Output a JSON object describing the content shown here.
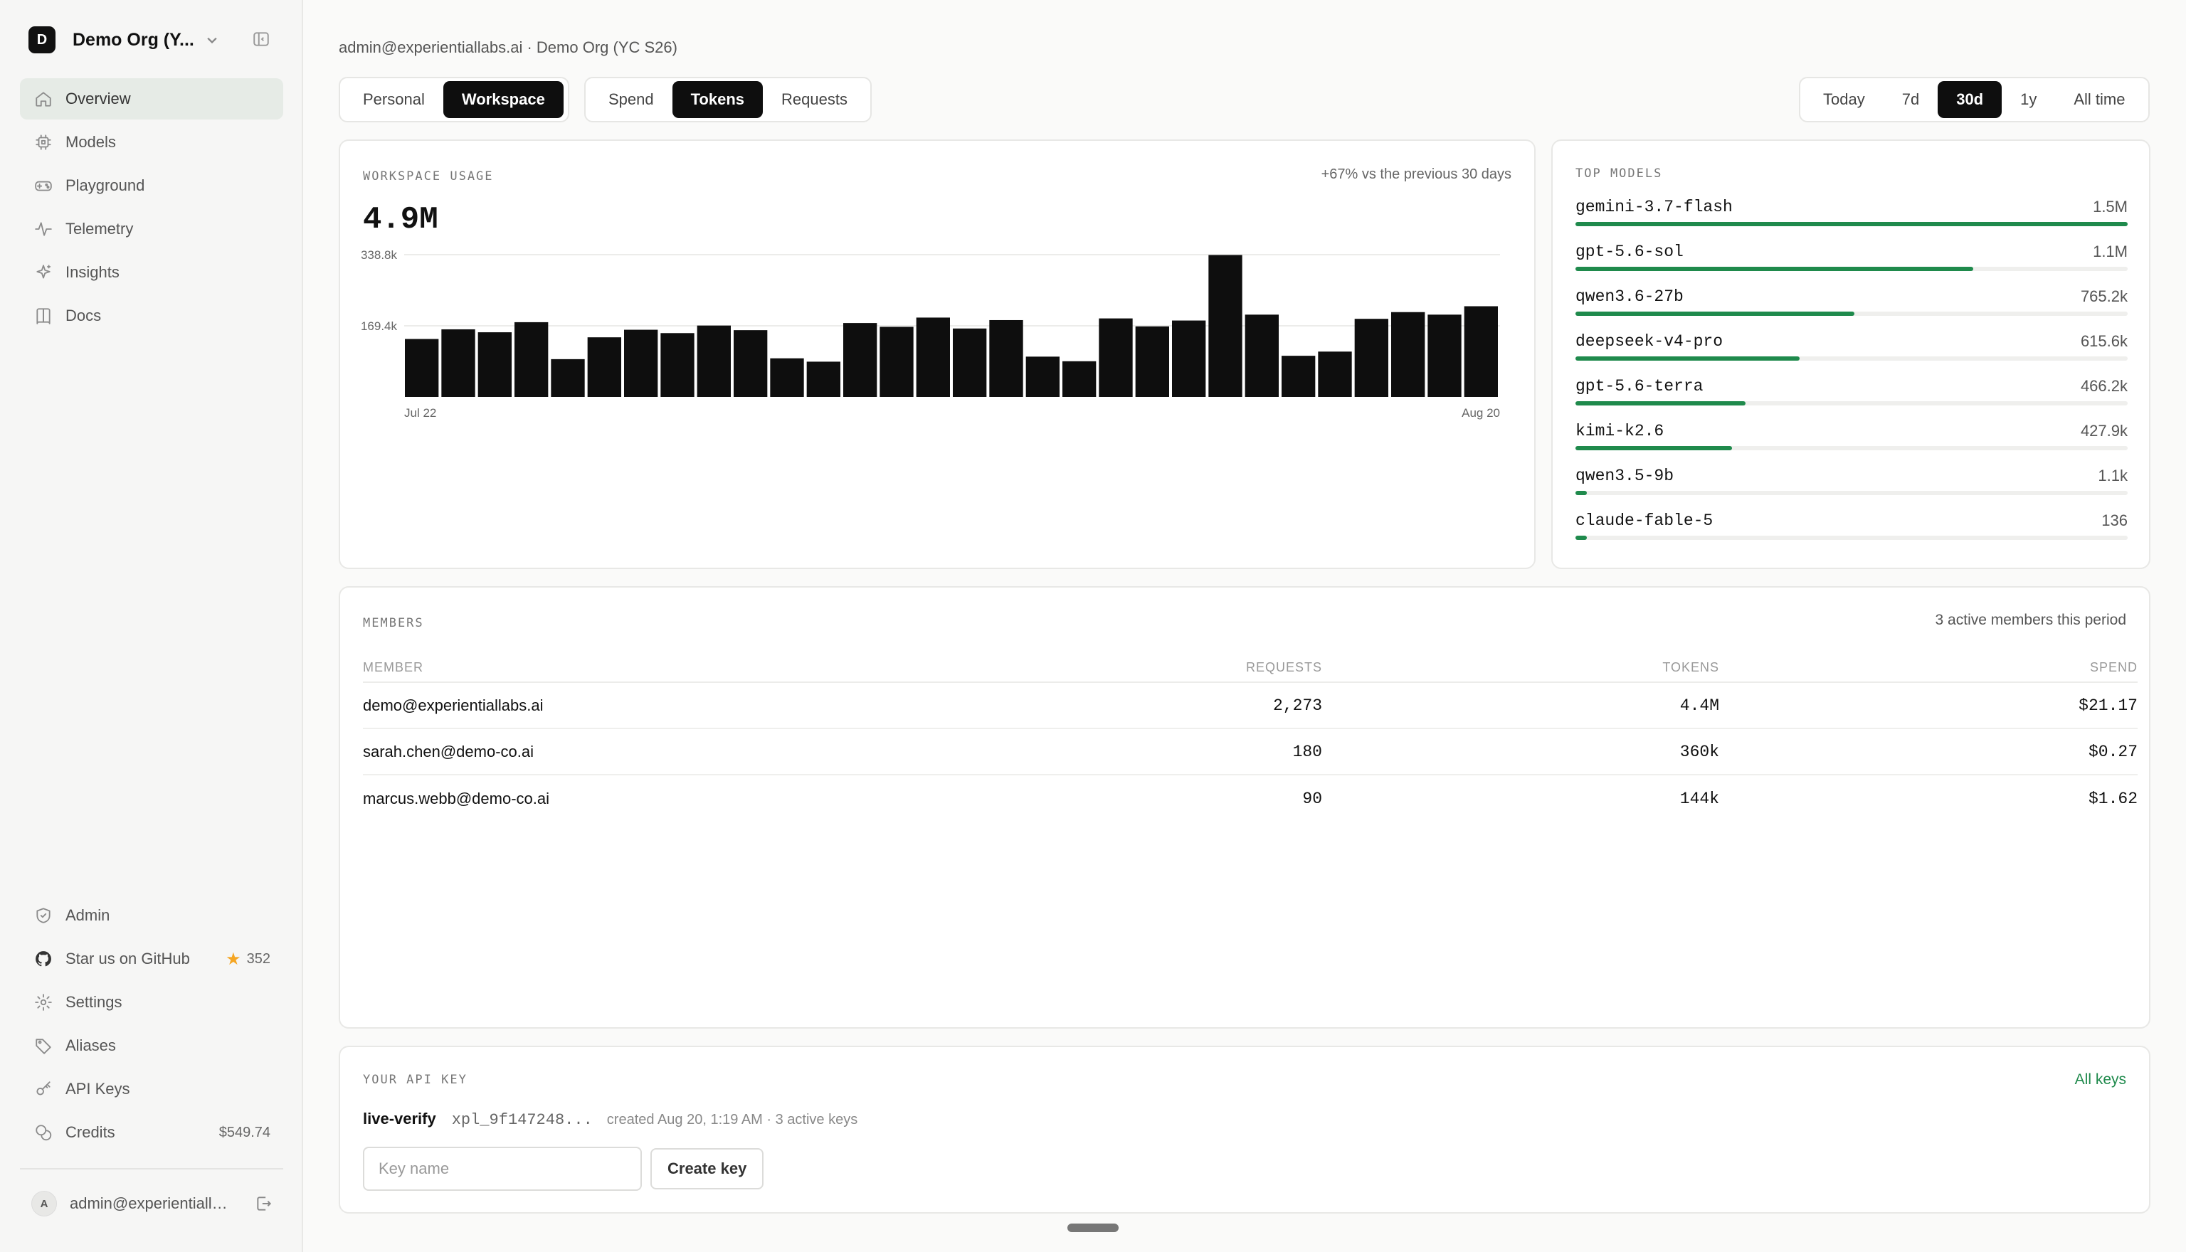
{
  "sidebar": {
    "org": {
      "initial": "D",
      "name": "Demo Org (Y..."
    },
    "nav": [
      {
        "label": "Overview",
        "icon": "home-icon",
        "active": true
      },
      {
        "label": "Models",
        "icon": "chip-icon"
      },
      {
        "label": "Playground",
        "icon": "gamepad-icon"
      },
      {
        "label": "Telemetry",
        "icon": "pulse-icon"
      },
      {
        "label": "Insights",
        "icon": "sparkles-icon"
      },
      {
        "label": "Docs",
        "icon": "book-icon"
      }
    ],
    "bottom": [
      {
        "label": "Admin",
        "icon": "shield-icon"
      },
      {
        "label": "Star us on GitHub",
        "icon": "github-icon",
        "badge": "352"
      },
      {
        "label": "Settings",
        "icon": "gear-icon"
      },
      {
        "label": "Aliases",
        "icon": "tag-icon"
      },
      {
        "label": "API Keys",
        "icon": "key-icon"
      },
      {
        "label": "Credits",
        "icon": "coins-icon",
        "badge": "$549.74"
      }
    ],
    "user": {
      "initial": "A",
      "email": "admin@experientiallabs.ai"
    }
  },
  "breadcrumb": "admin@experientiallabs.ai · Demo Org (YC S26)",
  "scope_tabs": [
    "Personal",
    "Workspace"
  ],
  "scope_active": "Workspace",
  "metric_tabs": [
    "Spend",
    "Tokens",
    "Requests"
  ],
  "metric_active": "Tokens",
  "range_tabs": [
    "Today",
    "7d",
    "30d",
    "1y",
    "All time"
  ],
  "range_active": "30d",
  "usage": {
    "label": "WORKSPACE USAGE",
    "total": "4.9M",
    "delta": "+67% vs the previous 30 days"
  },
  "chart_data": {
    "type": "bar",
    "y_ticks": [
      "338.8k",
      "169.4k"
    ],
    "y_tick_values": [
      338800,
      169400
    ],
    "x_start_label": "Jul 22",
    "x_end_label": "Aug 20",
    "ylim": [
      0,
      338800
    ],
    "values": [
      138000,
      161000,
      154000,
      178000,
      90000,
      142000,
      160000,
      152000,
      170000,
      159000,
      92000,
      84000,
      176000,
      167000,
      189000,
      163000,
      183000,
      96000,
      85000,
      187000,
      168000,
      182000,
      338000,
      196000,
      98000,
      108000,
      186000,
      202000,
      196000,
      216000
    ]
  },
  "top_models": {
    "label": "TOP MODELS",
    "items": [
      {
        "name": "gemini-3.7-flash",
        "value": "1.5M",
        "fraction": 1.0
      },
      {
        "name": "gpt-5.6-sol",
        "value": "1.1M",
        "fraction": 0.72
      },
      {
        "name": "qwen3.6-27b",
        "value": "765.2k",
        "fraction": 0.505
      },
      {
        "name": "deepseek-v4-pro",
        "value": "615.6k",
        "fraction": 0.406
      },
      {
        "name": "gpt-5.6-terra",
        "value": "466.2k",
        "fraction": 0.308
      },
      {
        "name": "kimi-k2.6",
        "value": "427.9k",
        "fraction": 0.283
      },
      {
        "name": "qwen3.5-9b",
        "value": "1.1k",
        "fraction": 0.02
      },
      {
        "name": "claude-fable-5",
        "value": "136",
        "fraction": 0.02
      }
    ]
  },
  "members": {
    "label": "MEMBERS",
    "note": "3 active members this period",
    "columns": [
      "MEMBER",
      "REQUESTS",
      "TOKENS",
      "SPEND"
    ],
    "rows": [
      [
        "demo@experientiallabs.ai",
        "2,273",
        "4.4M",
        "$21.17"
      ],
      [
        "sarah.chen@demo-co.ai",
        "180",
        "360k",
        "$0.27"
      ],
      [
        "marcus.webb@demo-co.ai",
        "90",
        "144k",
        "$1.62"
      ]
    ]
  },
  "api_key": {
    "label": "YOUR API KEY",
    "all_keys": "All keys",
    "name": "live-verify",
    "prefix": "xpl_9f147248...",
    "meta": "created Aug 20, 1:19 AM · 3 active keys",
    "input_placeholder": "Key name",
    "create_label": "Create key"
  },
  "colors": {
    "accent": "#1f8a4c",
    "bar": "#0e0e0e",
    "active_nav": "#e6ebe6"
  }
}
